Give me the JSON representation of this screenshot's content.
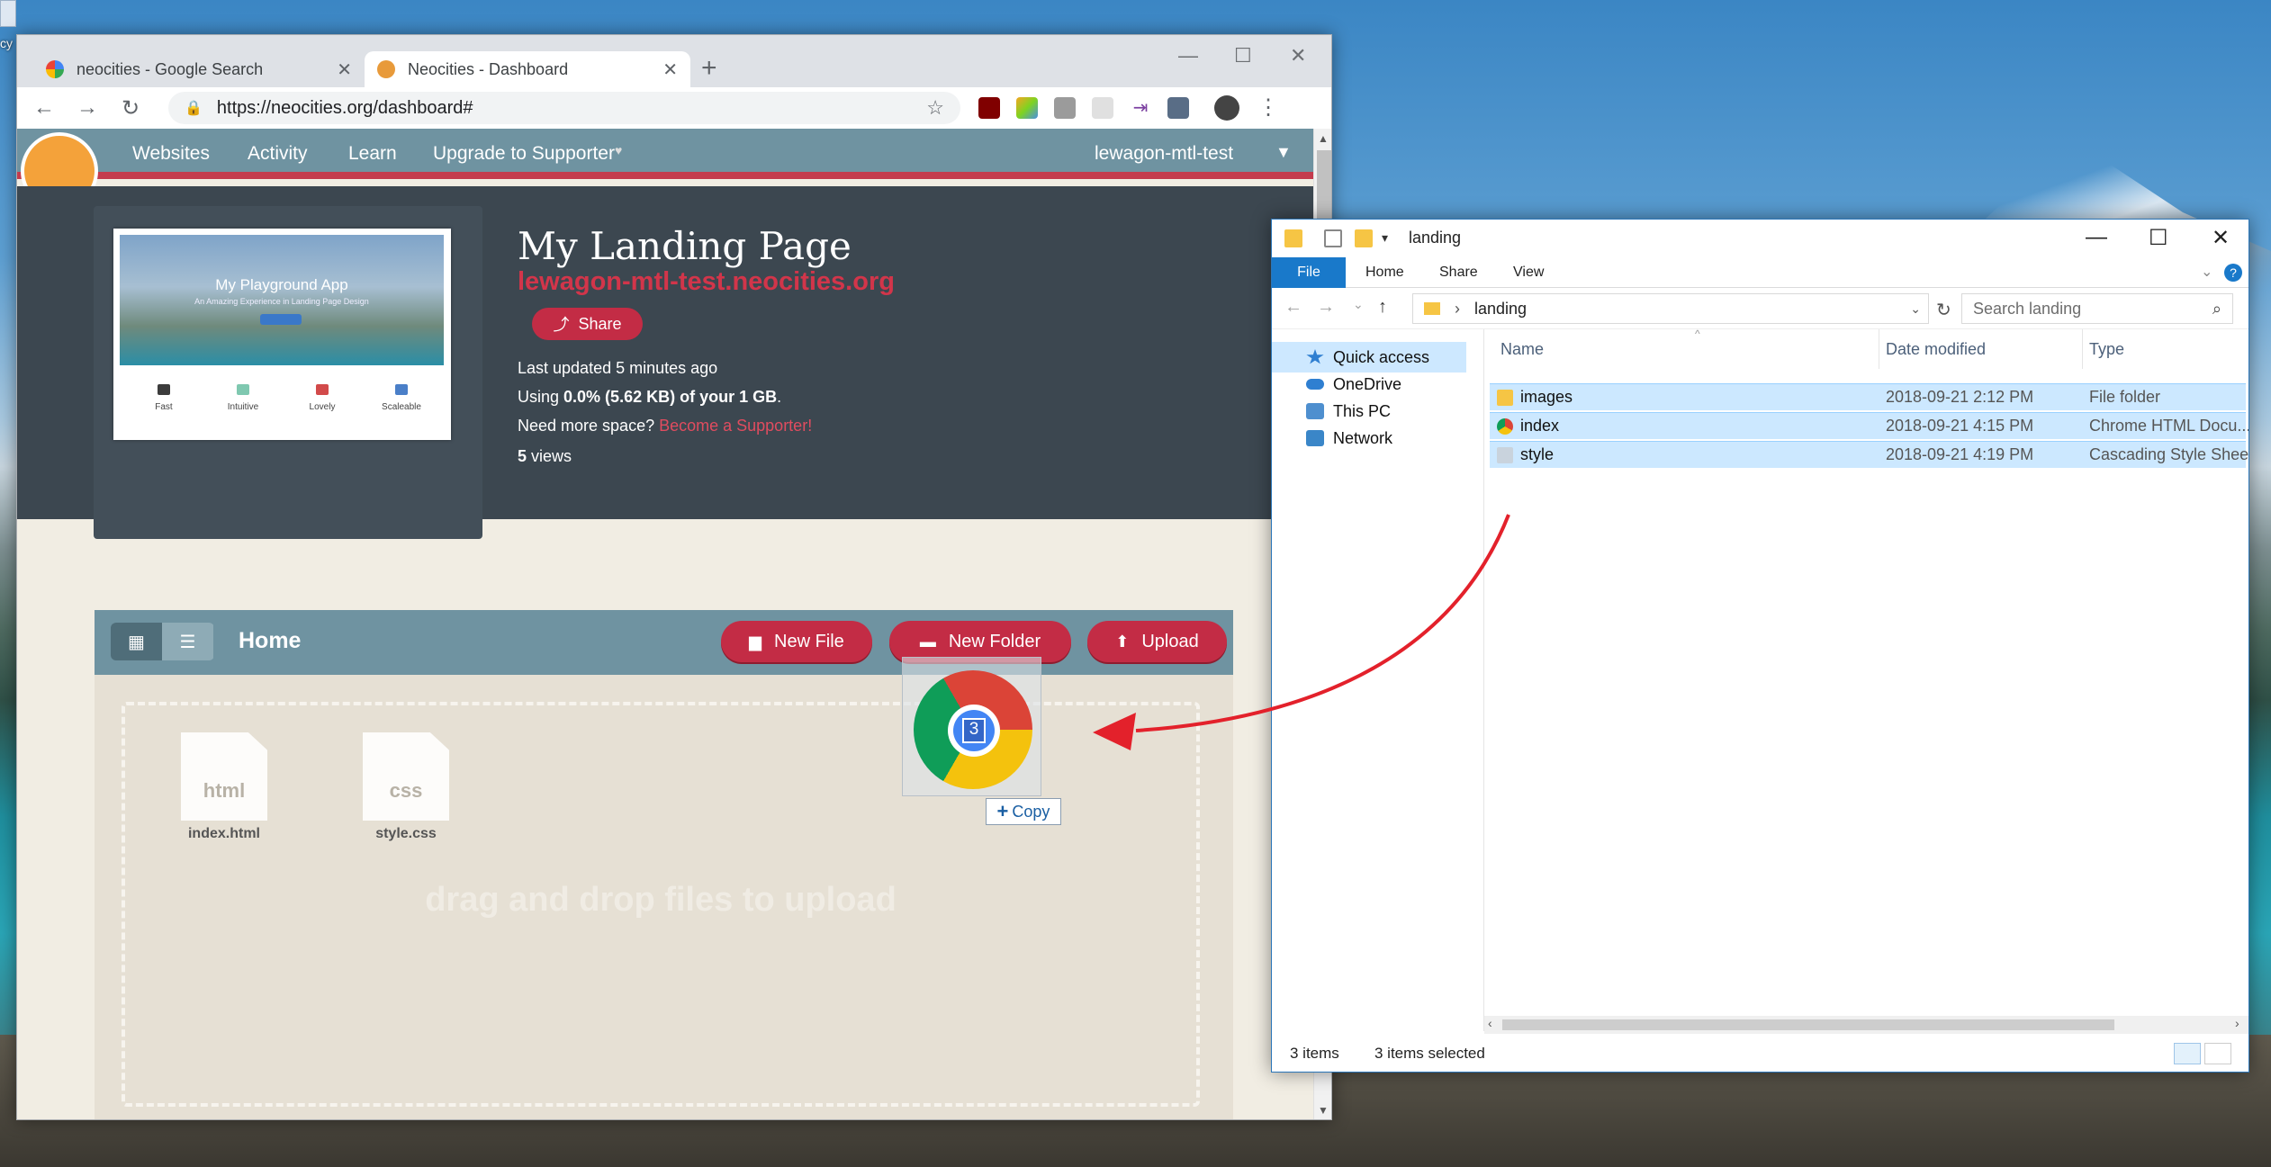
{
  "colors": {
    "nc_nav": "#6f93a1",
    "nc_red": "#c32c45",
    "nc_dark": "#3c4750",
    "explorer_select": "#cce8ff",
    "explorer_accent": "#1979ca"
  },
  "desktop": {
    "icon_label": "cy"
  },
  "chrome": {
    "tabs": [
      {
        "title": "neocities - Google Search",
        "icon": "google-g-icon"
      },
      {
        "title": "Neocities - Dashboard",
        "icon": "neocities-cat-icon"
      }
    ],
    "new_tab": "+",
    "window_controls": {
      "minimize": "—",
      "maximize": "☐",
      "close": "✕"
    },
    "nav": {
      "back": "←",
      "forward": "→",
      "reload": "↻"
    },
    "url": "https://neocities.org/dashboard#",
    "star": "☆"
  },
  "neocities": {
    "nav": [
      "Websites",
      "Activity",
      "Learn",
      "Upgrade to Supporter"
    ],
    "heart": "♥",
    "user": "lewagon-mtl-test",
    "caret": "▼",
    "thumbnail": {
      "title": "My Playground App",
      "subtitle": "An Amazing Experience in Landing Page Design",
      "features": [
        {
          "name": "Fast",
          "color": "#3c3c3c"
        },
        {
          "name": "Intuitive",
          "color": "#7fc8b0"
        },
        {
          "name": "Lovely",
          "color": "#d24a4a"
        },
        {
          "name": "Scaleable",
          "color": "#4a7fc8"
        }
      ]
    },
    "site_title": "My Landing Page",
    "site_url": "lewagon-mtl-test.neocities.org",
    "share": "Share",
    "share_icon": "share-icon",
    "last_updated": "Last updated 5 minutes ago",
    "usage": {
      "prefix": "Using ",
      "bold": "0.0% (5.62 KB) of your 1 GB",
      "suffix": "."
    },
    "more_space": {
      "text": "Need more space? ",
      "link": "Become a Supporter!"
    },
    "views": {
      "count": "5",
      "label": " views"
    },
    "file_manager": {
      "title": "Home",
      "buttons": [
        {
          "label": "New File",
          "icon": "file-icon"
        },
        {
          "label": "New Folder",
          "icon": "folder-icon"
        },
        {
          "label": "Upload",
          "icon": "upload-icon"
        }
      ],
      "files": [
        {
          "ext": "html",
          "name": "index.html"
        },
        {
          "ext": "css",
          "name": "style.css"
        }
      ],
      "drop_text": "drag and drop files to upload"
    },
    "drag": {
      "count": "3",
      "tooltip": "Copy"
    }
  },
  "explorer": {
    "title": "landing",
    "window_controls": {
      "minimize": "—",
      "maximize": "☐",
      "close": "✕"
    },
    "ribbon": [
      "Home",
      "Share",
      "View"
    ],
    "file_tab": "File",
    "help": "?",
    "breadcrumb": "landing",
    "search_placeholder": "Search landing",
    "nav_pane": [
      {
        "label": "Quick access",
        "icon": "star-icon",
        "color": "#2f7fd1"
      },
      {
        "label": "OneDrive",
        "icon": "cloud-icon",
        "color": "#2f7fd1"
      },
      {
        "label": "This PC",
        "icon": "computer-icon",
        "color": "#4e8fcf"
      },
      {
        "label": "Network",
        "icon": "network-icon",
        "color": "#3a86c8"
      }
    ],
    "columns": [
      "Name",
      "Date modified",
      "Type"
    ],
    "rows": [
      {
        "name": "images",
        "date": "2018-09-21 2:12 PM",
        "type": "File folder",
        "icon": "folder-icon",
        "color": "#f6c544"
      },
      {
        "name": "index",
        "date": "2018-09-21 4:15 PM",
        "type": "Chrome HTML Docu...",
        "icon": "chrome-icon",
        "color": "#db4437"
      },
      {
        "name": "style",
        "date": "2018-09-21 4:19 PM",
        "type": "Cascading Style Shee...",
        "icon": "css-file-icon",
        "color": "#c9d3dd"
      }
    ],
    "status": {
      "items": "3 items",
      "selected": "3 items selected"
    }
  }
}
